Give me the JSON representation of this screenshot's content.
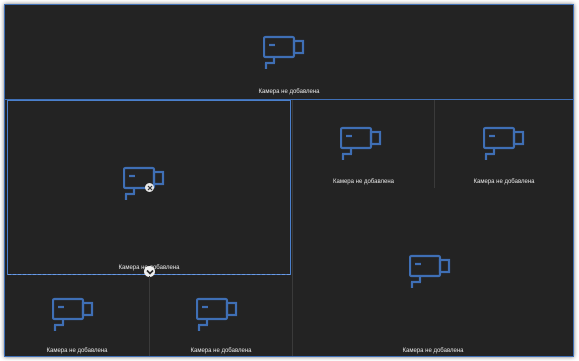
{
  "accent_color": "#3f6fb5",
  "background_color": "#232323",
  "icons": {
    "camera": "camera-icon",
    "remove": "close-icon",
    "expand": "chevron-down-icon"
  },
  "cells": [
    {
      "id": "cell-1",
      "label": "Камера не добавлена"
    },
    {
      "id": "cell-2",
      "label": "Камера не добавлена"
    },
    {
      "id": "cell-3",
      "label": "Камера не добавлена"
    },
    {
      "id": "cell-4",
      "label": "Камера не добавлена"
    },
    {
      "id": "cell-5",
      "label": "Камера не добавлена"
    },
    {
      "id": "cell-6",
      "label": "Камера не добавлена"
    },
    {
      "id": "cell-7",
      "label": "Камера не добавлена"
    }
  ]
}
